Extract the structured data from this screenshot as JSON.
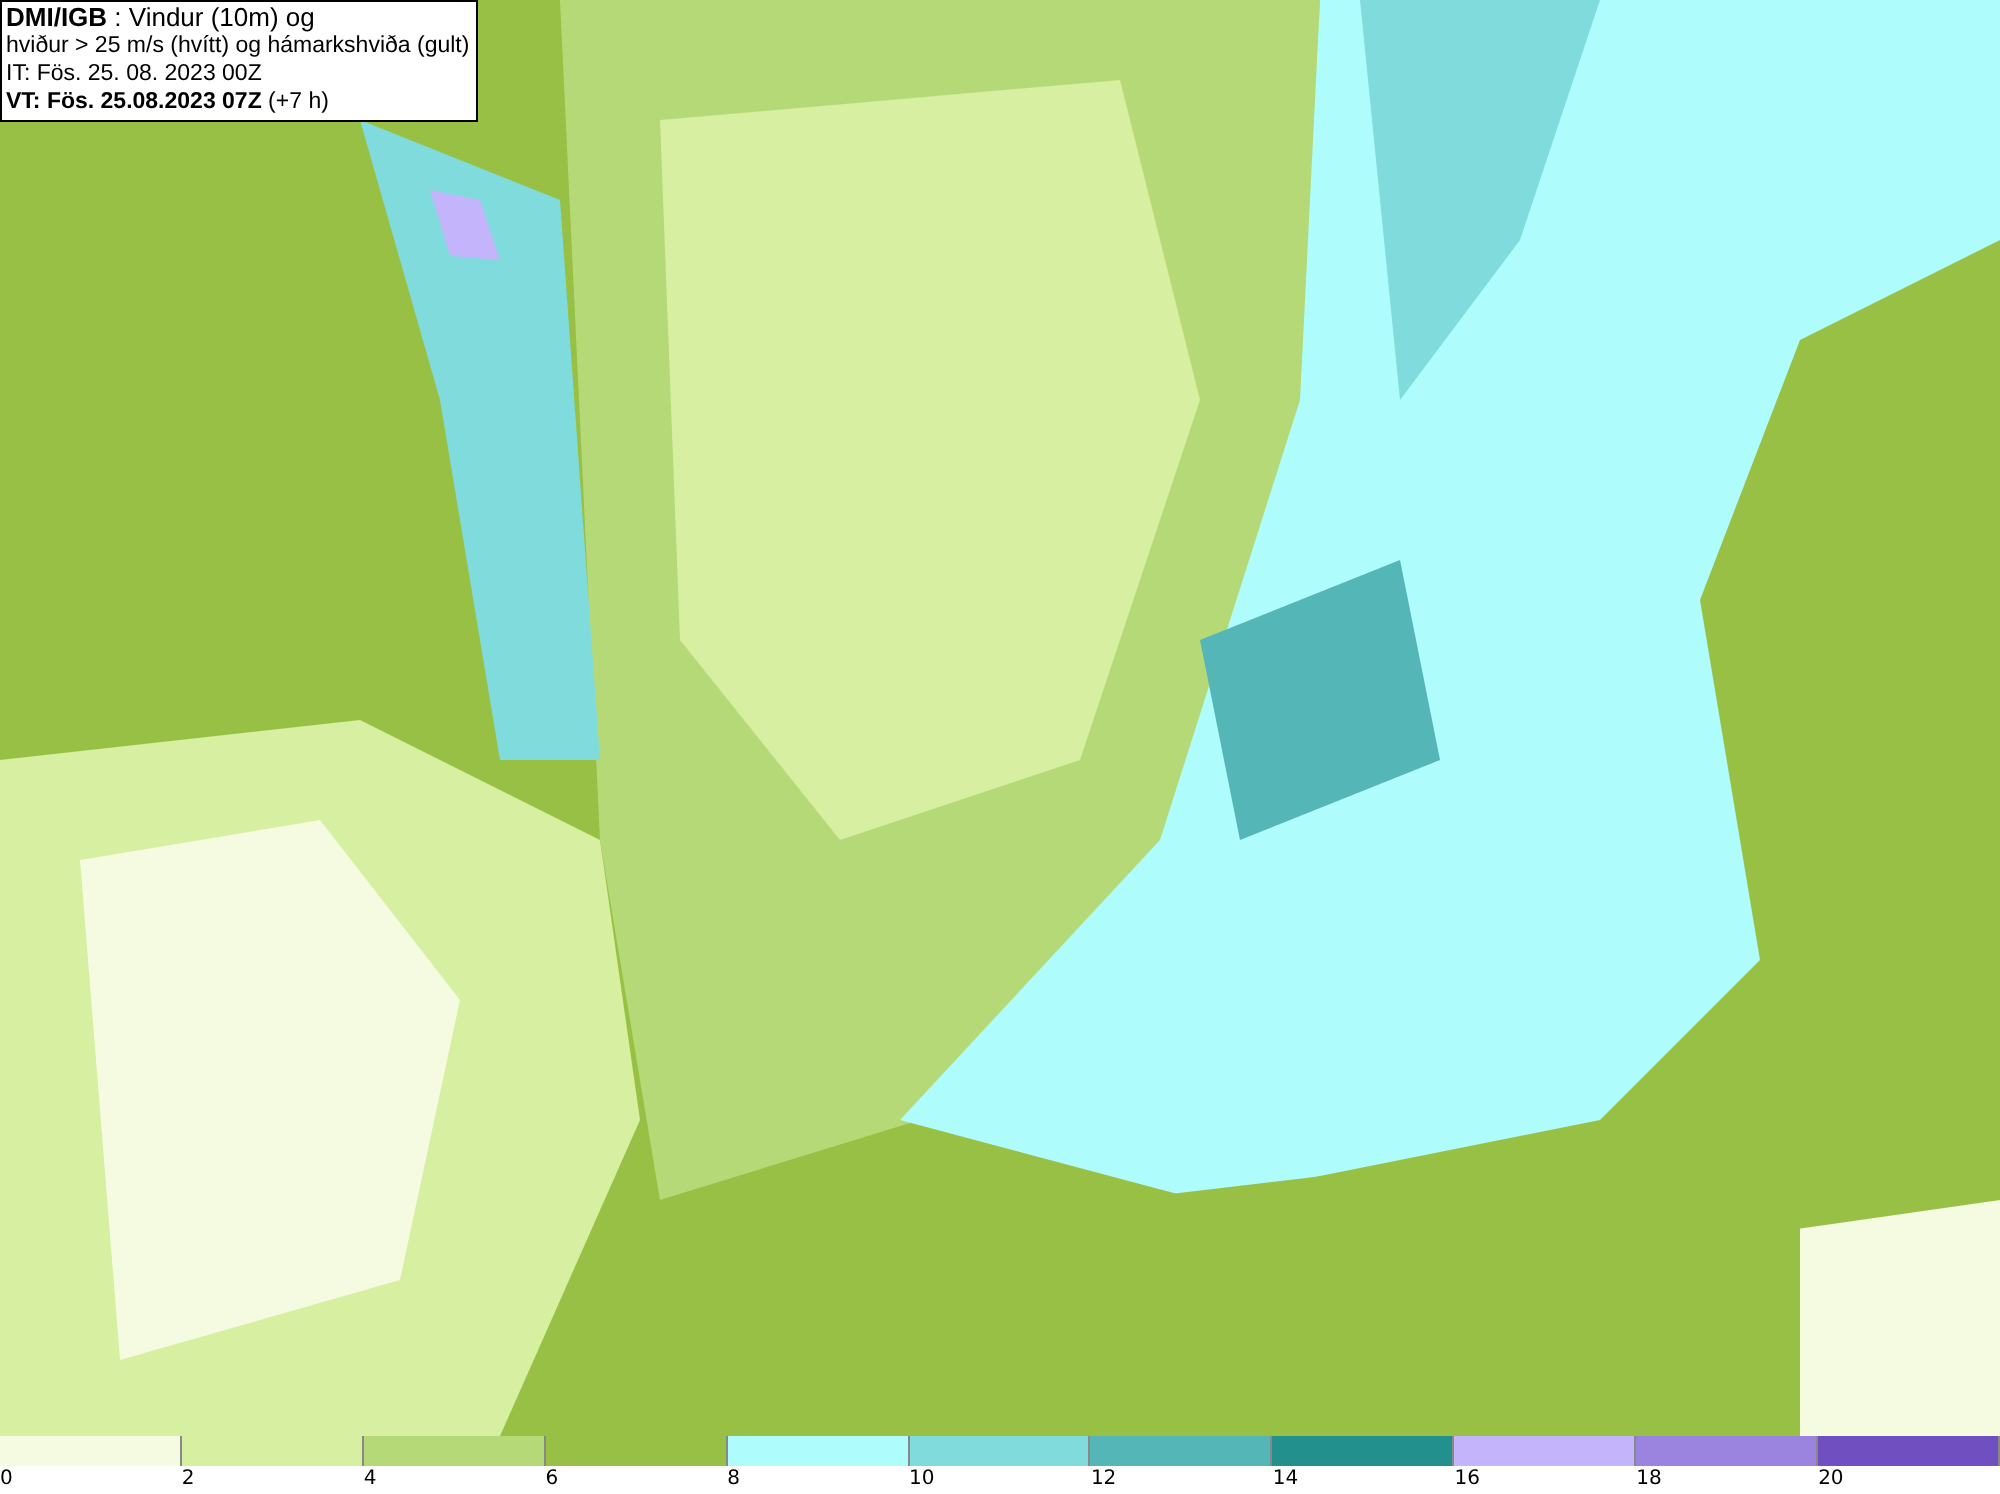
{
  "title_box": {
    "lines": [
      "**DMI/IGB** : Vindur (10m) og",
      "hviður > 25 m/s (hvítt) og hámarkshviða (gult)",
      "IT: Fös. 25. 08. 2023 00Z",
      "**VT: Fös. 25.08.2023 07Z** (+7 h)"
    ]
  },
  "legend": {
    "segments": [
      {
        "color": "#f4fbe0"
      },
      {
        "color": "#d6efa0"
      },
      {
        "color": "#b6d978"
      },
      {
        "color": "#98c044"
      },
      {
        "color": "#aefcfc"
      },
      {
        "color": "#80dcdc"
      },
      {
        "color": "#54b6b6"
      },
      {
        "color": "#22908c"
      },
      {
        "color": "#c4b4fc"
      },
      {
        "color": "#9a84e0"
      },
      {
        "color": "#7050c0"
      }
    ],
    "ticks": [
      "0",
      "2",
      "4",
      "6",
      "8",
      "10",
      "12",
      "14",
      "16",
      "18",
      "20"
    ]
  }
}
